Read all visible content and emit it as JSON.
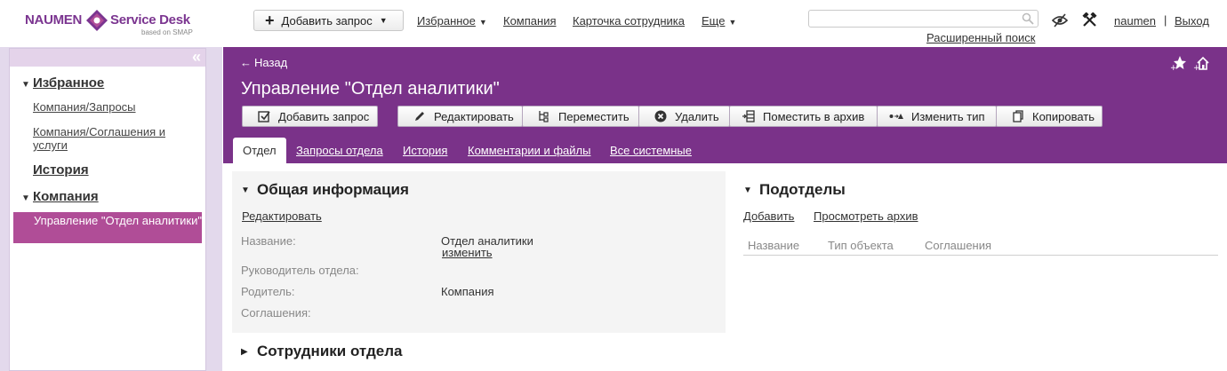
{
  "logo": {
    "left": "NAUMEN",
    "right": "Service Desk",
    "sub": "based on SMAP"
  },
  "header": {
    "add_request": "Добавить запрос",
    "nav": [
      "Избранное",
      "Компания",
      "Карточка сотрудника",
      "Еще"
    ],
    "search_placeholder": "",
    "advanced_search": "Расширенный поиск",
    "user": "naumen",
    "separator": "|",
    "logout": "Выход"
  },
  "sidebar": {
    "sections": {
      "favorites": "Избранное",
      "history": "История",
      "company": "Компания"
    },
    "items": {
      "company_requests": "Компания/Запросы",
      "company_agreements": "Компания/Соглашения и услуги",
      "active": "Управление \"Отдел аналитики\""
    }
  },
  "page": {
    "back": "Назад",
    "title": "Управление \"Отдел аналитики\"",
    "toolbar": [
      "Добавить запрос",
      "Редактировать",
      "Переместить",
      "Удалить",
      "Поместить в архив",
      "Изменить тип",
      "Копировать"
    ],
    "tabs": [
      "Отдел",
      "Запросы отдела",
      "История",
      "Комментарии и файлы",
      "Все системные"
    ]
  },
  "general_info": {
    "title": "Общая информация",
    "edit": "Редактировать",
    "fields": {
      "name_label": "Название:",
      "name_value": "Отдел аналитики",
      "name_change": "изменить",
      "head_label": "Руководитель отдела:",
      "parent_label": "Родитель:",
      "parent_value": "Компания",
      "agreements_label": "Соглашения:"
    }
  },
  "subdivisions": {
    "title": "Подотделы",
    "add": "Добавить",
    "archive": "Просмотреть архив",
    "columns": [
      "Название",
      "Тип объекта",
      "Соглашения"
    ]
  },
  "employees": {
    "title": "Сотрудники отдела"
  },
  "colors": {
    "brand": "#7a3289",
    "active_item": "#b04d97",
    "sidebar_bg": "#e3d9ec"
  }
}
